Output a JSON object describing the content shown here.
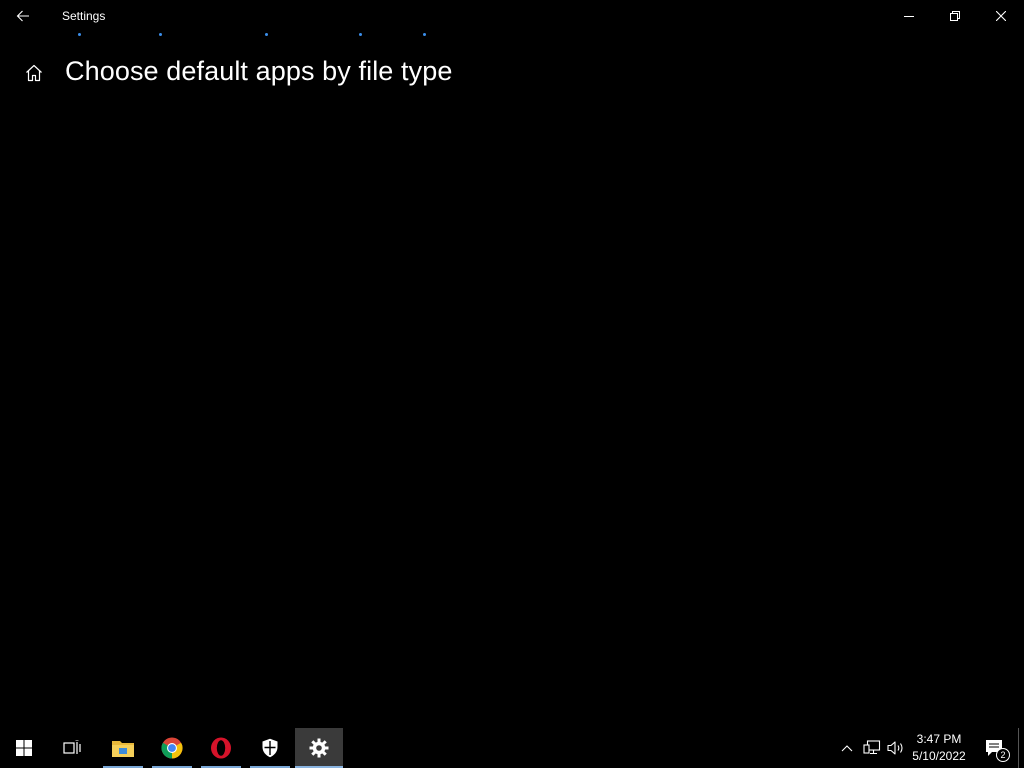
{
  "window": {
    "title": "Settings",
    "back_icon": "back-arrow-icon",
    "minimize_icon": "minimize-icon",
    "restore_icon": "restore-icon",
    "close_icon": "close-icon"
  },
  "page": {
    "home_icon": "home-icon",
    "title": "Choose default apps by file type",
    "loading_indicator": "progress-dots"
  },
  "taskbar": {
    "start_icon": "windows-start-icon",
    "taskview_icon": "task-view-icon",
    "apps": [
      {
        "name": "File Explorer",
        "icon": "file-explorer-icon",
        "open": true
      },
      {
        "name": "Google Chrome",
        "icon": "chrome-icon",
        "open": true
      },
      {
        "name": "Opera",
        "icon": "opera-icon",
        "open": true
      },
      {
        "name": "Windows Security",
        "icon": "shield-icon",
        "open": true
      },
      {
        "name": "Settings",
        "icon": "gear-icon",
        "open": true,
        "active": true
      }
    ],
    "tray": {
      "chevron_icon": "chevron-up-icon",
      "network_icon": "network-icon",
      "volume_icon": "volume-icon",
      "time": "3:47 PM",
      "date": "5/10/2022",
      "notifications_icon": "action-center-icon",
      "notification_count": "2"
    }
  },
  "colors": {
    "background": "#000000",
    "accent": "#3b8eea",
    "active_taskbar_item": "#3a3a3a"
  }
}
